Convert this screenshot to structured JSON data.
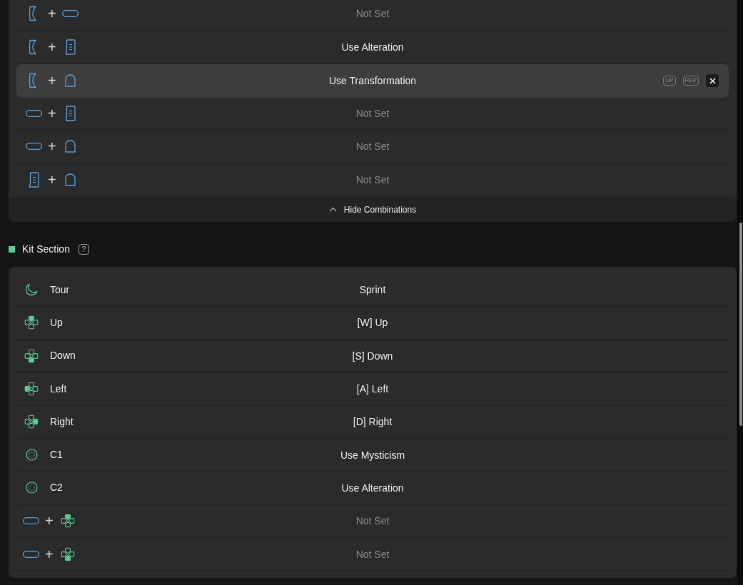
{
  "combinations": {
    "rows": [
      {
        "keys": [
          {
            "kind": "paddle"
          },
          {
            "kind": "pill"
          }
        ],
        "joiner": "+",
        "action": "Not Set",
        "set": false,
        "selected": false
      },
      {
        "keys": [
          {
            "kind": "paddle"
          },
          {
            "kind": "grip"
          }
        ],
        "joiner": "+",
        "action": "Use Alteration",
        "set": true,
        "selected": false
      },
      {
        "keys": [
          {
            "kind": "paddle"
          },
          {
            "kind": "trigger"
          }
        ],
        "joiner": "+",
        "action": "Use Transformation",
        "set": true,
        "selected": true
      },
      {
        "keys": [
          {
            "kind": "pill"
          },
          {
            "kind": "grip"
          }
        ],
        "joiner": "+",
        "action": "Not Set",
        "set": false,
        "selected": false
      },
      {
        "keys": [
          {
            "kind": "pill"
          },
          {
            "kind": "trigger"
          }
        ],
        "joiner": "+",
        "action": "Not Set",
        "set": false,
        "selected": false
      },
      {
        "keys": [
          {
            "kind": "grip"
          },
          {
            "kind": "trigger"
          }
        ],
        "joiner": "+",
        "action": "Not Set",
        "set": false,
        "selected": false
      }
    ],
    "row_actions": {
      "move_up": "UP",
      "replace": "REP"
    },
    "toggle": "Hide Combinations"
  },
  "kit_section": {
    "title": "Kit Section",
    "help": "?",
    "rows": [
      {
        "kind": "single",
        "icon": {
          "kind": "moon"
        },
        "label": "Tour",
        "action": "Sprint",
        "set": true
      },
      {
        "kind": "single",
        "icon": {
          "kind": "dpad",
          "up": true,
          "down": false,
          "left": false,
          "right": false
        },
        "label": "Up",
        "action": "[W] Up",
        "set": true
      },
      {
        "kind": "single",
        "icon": {
          "kind": "dpad",
          "up": false,
          "down": true,
          "left": false,
          "right": false
        },
        "label": "Down",
        "action": "[S] Down",
        "set": true
      },
      {
        "kind": "single",
        "icon": {
          "kind": "dpad",
          "up": false,
          "down": false,
          "left": true,
          "right": false
        },
        "label": "Left",
        "action": "[A] Left",
        "set": true
      },
      {
        "kind": "single",
        "icon": {
          "kind": "dpad",
          "up": false,
          "down": false,
          "left": false,
          "right": true
        },
        "label": "Right",
        "action": "[D] Right",
        "set": true
      },
      {
        "kind": "single",
        "icon": {
          "kind": "c1"
        },
        "label": "C1",
        "action": "Use Mysticism",
        "set": true
      },
      {
        "kind": "single",
        "icon": {
          "kind": "c2"
        },
        "label": "C2",
        "action": "Use Alteration",
        "set": true
      },
      {
        "kind": "combo",
        "keys": [
          {
            "kind": "pill"
          },
          {
            "kind": "dpad",
            "up": true,
            "down": false,
            "left": false,
            "right": false
          }
        ],
        "joiner": "+",
        "action": "Not Set",
        "set": false
      },
      {
        "kind": "combo",
        "keys": [
          {
            "kind": "pill"
          },
          {
            "kind": "dpad",
            "up": false,
            "down": true,
            "left": false,
            "right": false
          }
        ],
        "joiner": "+",
        "action": "Not Set",
        "set": false
      }
    ]
  }
}
